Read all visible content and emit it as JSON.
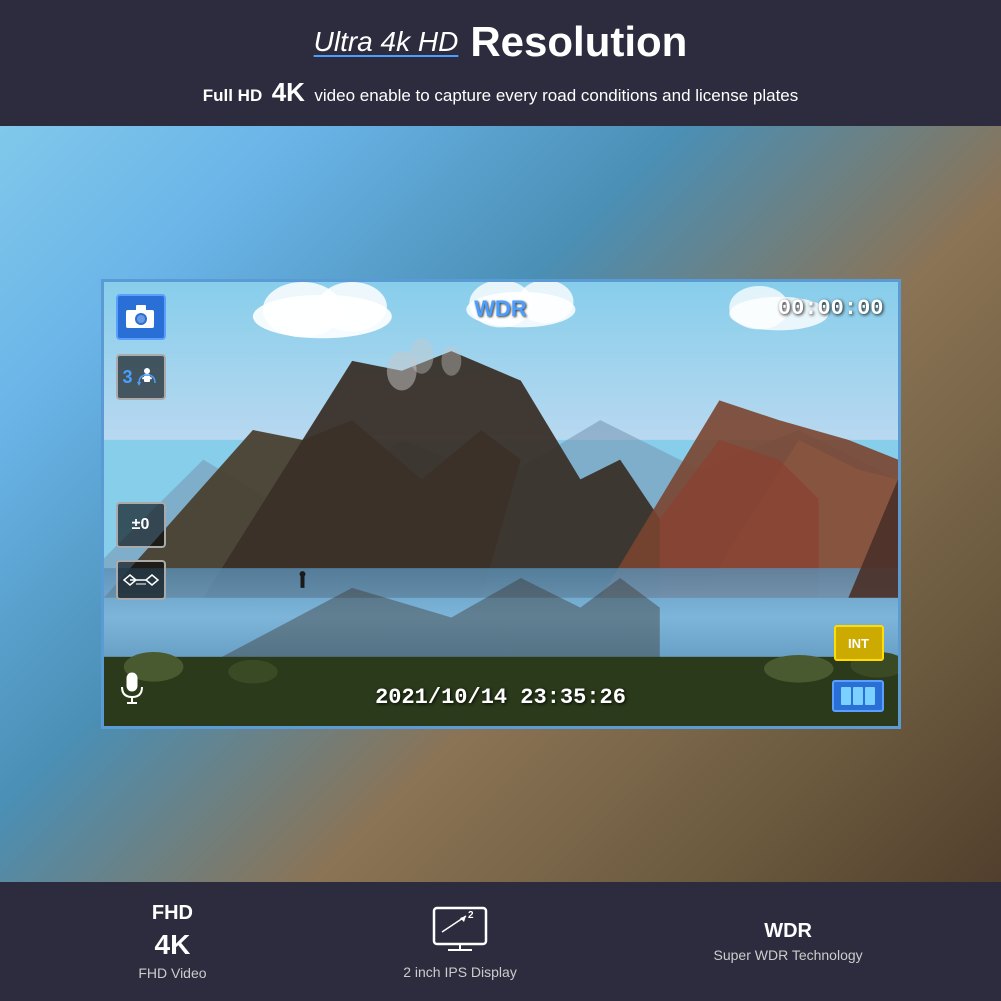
{
  "header": {
    "ultra4k_label": "Ultra 4k HD",
    "resolution_label": "Resolution",
    "fullhd_label": "Full HD",
    "fourk_label": "4K",
    "subtitle": "video enable to capture every road conditions and license plates"
  },
  "viewfinder": {
    "wdr_label": "WDR",
    "timecode": "00:00:00",
    "loop_number": "3",
    "ev_label": "±0",
    "int_label": "INT",
    "datetime": "2021/10/14  23:35:26"
  },
  "features": [
    {
      "label_top": "FHD",
      "label_large": "4K",
      "label_sub": "FHD Video",
      "icon": "video-icon"
    },
    {
      "label_top": "",
      "label_large": "",
      "label_main": "2 inch IPS Display",
      "icon": "display-icon"
    },
    {
      "label_top": "WDR",
      "label_large": "",
      "label_sub": "Super WDR Technology",
      "icon": "wdr-icon"
    }
  ]
}
